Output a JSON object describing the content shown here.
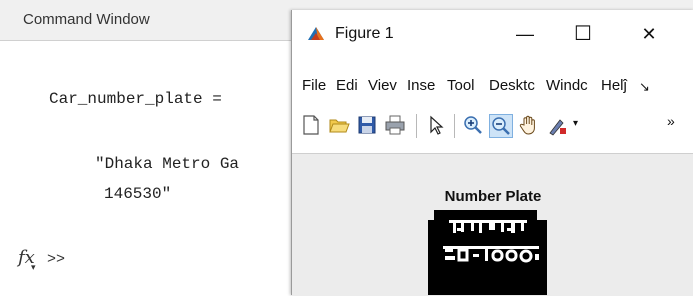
{
  "command_window": {
    "title": "Command Window",
    "lines": [
      "Car_number_plate =",
      "\"Dhaka Metro Ga",
      "146530\""
    ],
    "prompt_symbol": "fx",
    "prompt": ">>"
  },
  "figure": {
    "title": "Figure 1",
    "window_buttons": {
      "minimize": "—",
      "maximize": "☐",
      "close": "✕"
    },
    "menu": [
      "File",
      "Edit",
      "View",
      "Insert",
      "Tools",
      "Desktop",
      "Window",
      "Help"
    ],
    "menu_visible": [
      "Filе",
      "Edi",
      "Viev",
      "Inse",
      "Tool",
      "Desktϲ",
      "Windc",
      "Helĵ"
    ],
    "menu_overflow": "↘",
    "toolbar_icons": [
      "new-figure-icon",
      "open-icon",
      "save-icon",
      "print-icon",
      "pointer-icon",
      "zoom-in-icon",
      "zoom-out-icon",
      "pan-icon",
      "data-cursor-icon",
      "dropdown-icon"
    ],
    "toolbar_overflow": "»",
    "axes_title": "Number Plate"
  },
  "colors": {
    "titlebar_bg": "#f0f0f0",
    "figure_bg": "#ececec",
    "plate_bg": "#000000",
    "plate_fg": "#ffffff"
  }
}
